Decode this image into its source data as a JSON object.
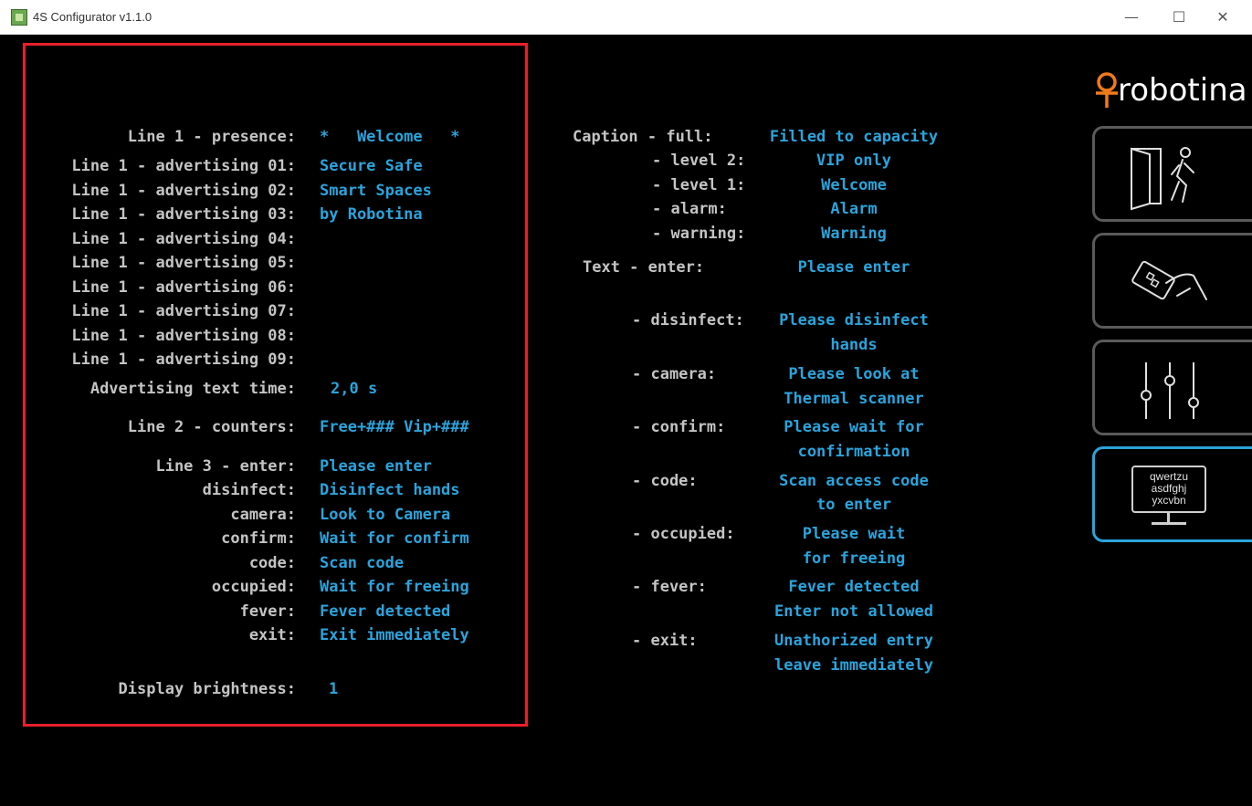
{
  "window": {
    "title": "4S Configurator v1.1.0",
    "minimize": "—",
    "maximize": "☐",
    "close": "✕"
  },
  "brand": {
    "logo_text": "robotina"
  },
  "left_panel": {
    "line1_presence_label": "Line 1 - presence:",
    "line1_presence_value": "*   Welcome   *",
    "advertising": [
      {
        "label": "Line 1 - advertising 01:",
        "value": "Secure Safe"
      },
      {
        "label": "Line 1 - advertising 02:",
        "value": "Smart Spaces"
      },
      {
        "label": "Line 1 - advertising 03:",
        "value": "by Robotina"
      },
      {
        "label": "Line 1 - advertising 04:",
        "value": ""
      },
      {
        "label": "Line 1 - advertising 05:",
        "value": ""
      },
      {
        "label": "Line 1 - advertising 06:",
        "value": ""
      },
      {
        "label": "Line 1 - advertising 07:",
        "value": ""
      },
      {
        "label": "Line 1 - advertising 08:",
        "value": ""
      },
      {
        "label": "Line 1 - advertising 09:",
        "value": ""
      }
    ],
    "adv_time_label": "Advertising text time:",
    "adv_time_value": "2,0 s",
    "line2_label": "Line 2 - counters:",
    "line2_value": "Free+### Vip+###",
    "line3": [
      {
        "label": "Line 3 - enter:",
        "value": "Please enter"
      },
      {
        "label": "disinfect:",
        "value": "Disinfect hands"
      },
      {
        "label": "camera:",
        "value": "Look to Camera"
      },
      {
        "label": "confirm:",
        "value": "Wait for confirm"
      },
      {
        "label": "code:",
        "value": "Scan code"
      },
      {
        "label": "occupied:",
        "value": "Wait for freeing"
      },
      {
        "label": "fever:",
        "value": "Fever detected"
      },
      {
        "label": "exit:",
        "value": "Exit immediately"
      }
    ],
    "brightness_label": "Display brightness:",
    "brightness_value": "1"
  },
  "right_panel": {
    "caption": [
      {
        "label": "Caption - full:",
        "value": "Filled to capacity"
      },
      {
        "label": "- level 2:",
        "value": "VIP only"
      },
      {
        "label": "- level 1:",
        "value": "Welcome"
      },
      {
        "label": "- alarm:",
        "value": "Alarm"
      },
      {
        "label": "- warning:",
        "value": "Warning"
      }
    ],
    "text": [
      {
        "label": "Text - enter:",
        "line1": "Please enter",
        "line2": ""
      },
      {
        "label": "- disinfect:",
        "line1": "Please disinfect",
        "line2": "hands"
      },
      {
        "label": "- camera:",
        "line1": "Please look at",
        "line2": "Thermal scanner"
      },
      {
        "label": "- confirm:",
        "line1": "Please wait for",
        "line2": "confirmation"
      },
      {
        "label": "- code:",
        "line1": "Scan access code",
        "line2": "to enter"
      },
      {
        "label": "- occupied:",
        "line1": "Please wait",
        "line2": "for freeing"
      },
      {
        "label": "- fever:",
        "line1": "Fever detected",
        "line2": "Enter not allowed"
      },
      {
        "label": "- exit:",
        "line1": "Unathorized entry",
        "line2": "leave immediately"
      }
    ]
  },
  "sidebar": {
    "items": [
      {
        "name": "door-person-icon"
      },
      {
        "name": "card-scan-icon"
      },
      {
        "name": "sliders-icon"
      },
      {
        "name": "keyboard-display-icon",
        "lines": [
          "qwertzu",
          "asdfghj",
          "yxcvbn"
        ],
        "active": true
      }
    ]
  }
}
